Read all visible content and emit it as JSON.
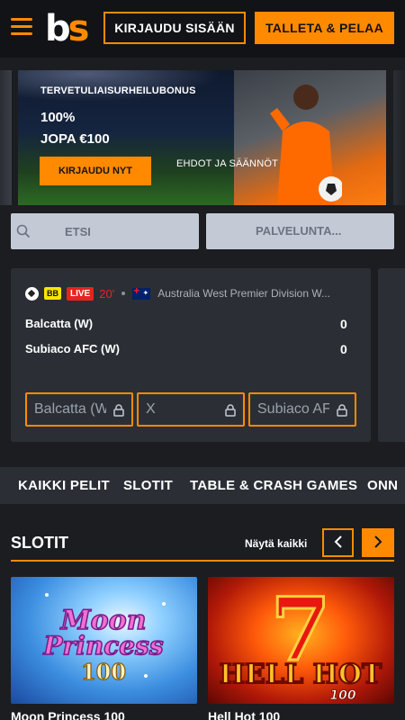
{
  "header": {
    "logo_b": "b",
    "logo_s": "s",
    "login_label": "KIRJAUDU SISÄÄN",
    "deposit_label": "TALLETA & PELAA"
  },
  "banner": {
    "subtitle": "TERVETULIAISURHEILUBONUS",
    "line1": "100%",
    "line2": "JOPA €100",
    "cta_label": "KIRJAUDU NYT",
    "terms_label": "EHDOT JA SÄÄNNÖT"
  },
  "search": {
    "placeholder": "ETSI",
    "providers_label": "PALVELUNTA..."
  },
  "match": {
    "bb_badge": "BB",
    "live_badge": "LIVE",
    "minute": "20'",
    "league": "Australia West Premier Division W...",
    "home_team": "Balcatta (W)",
    "away_team": "Subiaco AFC (W)",
    "home_score": "0",
    "away_score": "0",
    "odds": [
      "Balcatta (W)",
      "X",
      "Subiaco AFC (W)"
    ]
  },
  "tabs": [
    "KAIKKI PELIT",
    "SLOTIT",
    "TABLE & CRASH GAMES",
    "ONN"
  ],
  "section": {
    "title": "SLOTIT",
    "see_all": "Näytä kaikki"
  },
  "games": [
    {
      "name": "Moon Princess 100",
      "art_line1": "Moon",
      "art_line2": "Princess",
      "art_line3": "100"
    },
    {
      "name": "Hell Hot 100",
      "art_big": "7",
      "art_line1": "HELL HOT",
      "art_line2": "100"
    }
  ],
  "colors": {
    "accent": "#ff8a00",
    "background": "#1b1d21",
    "header": "#121316",
    "card": "#2b2f35",
    "live": "#e8231f",
    "bb": "#f7e600"
  }
}
